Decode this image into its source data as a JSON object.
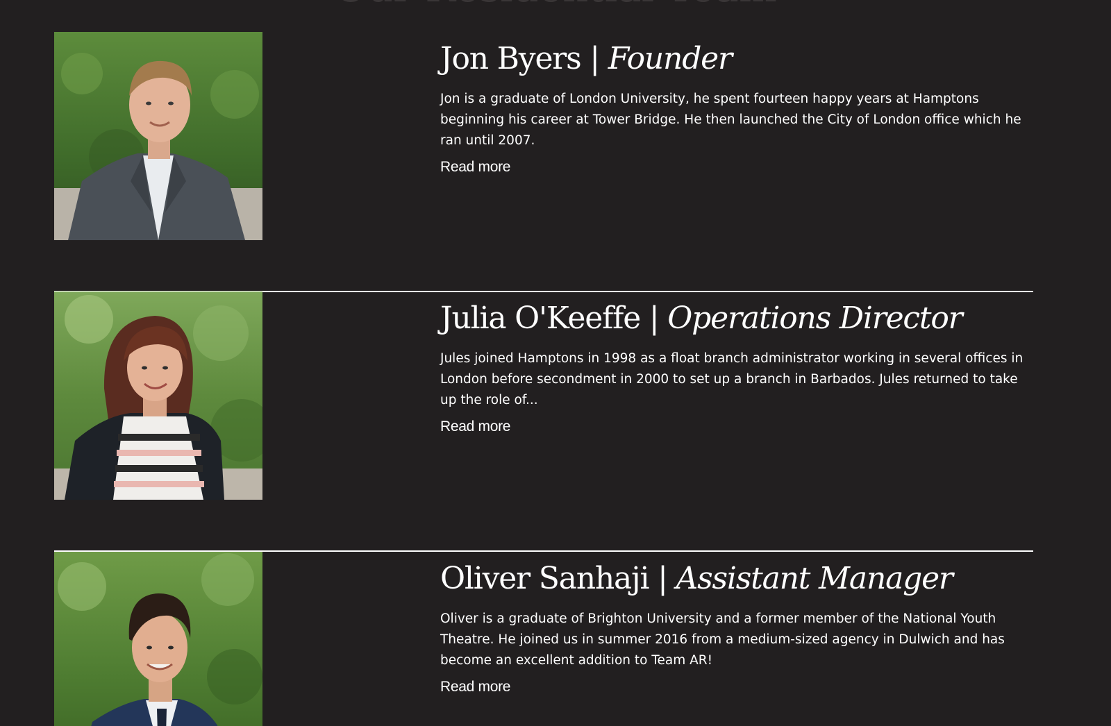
{
  "page": {
    "heading": "Our Residential Team"
  },
  "team": [
    {
      "name": "Jon Byers",
      "separator": " | ",
      "role": "Founder",
      "bio": "Jon is a graduate of London University, he spent fourteen happy years at Hamptons beginning his career at Tower Bridge. He then launched the City of London office which he ran until 2007.",
      "link_label": "Read more"
    },
    {
      "name": "Julia O'Keeffe",
      "separator": " | ",
      "role": "Operations Director",
      "bio": "Jules joined Hamptons in 1998 as a float branch administrator working in several offices in London before secondment in 2000 to set up a branch in Barbados. Jules returned to take up the role of...",
      "link_label": "Read more"
    },
    {
      "name": "Oliver Sanhaji",
      "separator": " | ",
      "role": "Assistant Manager",
      "bio": "Oliver is a graduate of Brighton University and a former member of the National Youth Theatre. He joined us in summer 2016 from a medium-sized agency in Dulwich and has become an excellent addition to Team AR!",
      "link_label": "Read more"
    }
  ],
  "colors": {
    "background": "#221f20",
    "text": "#ffffff",
    "divider": "#ffffff",
    "hedge_green": "#4f7a35"
  }
}
